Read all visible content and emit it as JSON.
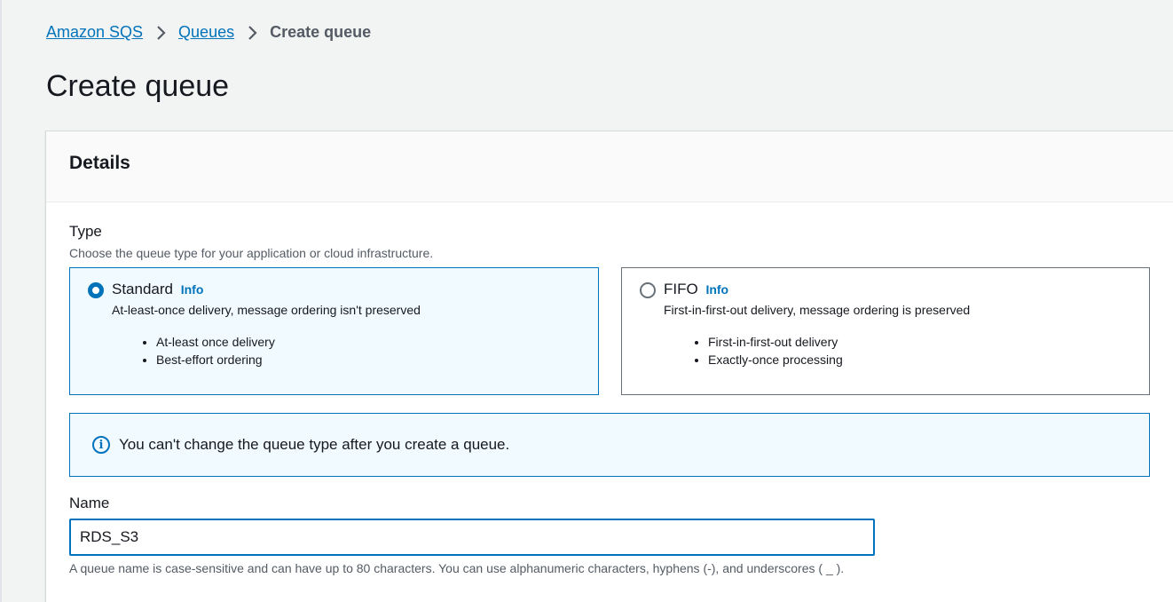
{
  "breadcrumb": {
    "items": [
      {
        "label": "Amazon SQS"
      },
      {
        "label": "Queues"
      }
    ],
    "current": "Create queue"
  },
  "page_title": "Create queue",
  "details": {
    "heading": "Details",
    "type": {
      "label": "Type",
      "description": "Choose the queue type for your application or cloud infrastructure.",
      "options": [
        {
          "title": "Standard",
          "info": "Info",
          "description": "At-least-once delivery, message ordering isn't preserved",
          "bullets": [
            "At-least once delivery",
            "Best-effort ordering"
          ],
          "selected": true
        },
        {
          "title": "FIFO",
          "info": "Info",
          "description": "First-in-first-out delivery, message ordering is preserved",
          "bullets": [
            "First-in-first-out delivery",
            "Exactly-once processing"
          ],
          "selected": false
        }
      ]
    },
    "alert": {
      "icon": "info-icon",
      "text": "You can't change the queue type after you create a queue."
    },
    "name": {
      "label": "Name",
      "value": "RDS_S3",
      "hint": "A queue name is case-sensitive and can have up to 80 characters. You can use alphanumeric characters, hyphens (-), and underscores ( _ )."
    }
  },
  "colors": {
    "accent": "#0073bb",
    "background": "#f2f3f3"
  }
}
